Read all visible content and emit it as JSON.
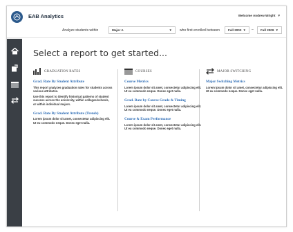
{
  "app": {
    "title": "EAB  Analytics",
    "welcome": "Welcome Andrew Wright",
    "logo_icon": "eab-logo-icon"
  },
  "filters": {
    "label_analyze": "Analyze students within",
    "major_value": "Major A",
    "label_enrolled": "who first enrolled between",
    "from_value": "Fall 2003",
    "dash": "–",
    "to_value": "Fall 2009"
  },
  "sidebar": {
    "items": [
      {
        "icon": "home-icon"
      },
      {
        "icon": "report-edit-icon"
      },
      {
        "icon": "courses-icon"
      },
      {
        "icon": "switch-arrows-icon"
      }
    ]
  },
  "main": {
    "heading": "Select a report to get started...",
    "columns": [
      {
        "title": "GRADUATION RATES",
        "icon": "bar-chart-icon",
        "reports": [
          {
            "title": "Grad. Rate By Student Attribute",
            "desc": "This report analyzes graduation rates for students across various attributes.",
            "desc2": "Use this report to identify historical patterns of student success across the university, within colleges/schools, or within individual majors."
          },
          {
            "title": "Grad. Rate By Student Attribute (Trends)",
            "desc": "Lorem ipsum dolor sit amet, consectetur adipiscing elit. Ut eu commodo neque. Donec eget nulla."
          }
        ]
      },
      {
        "title": "COURSES",
        "icon": "courses-icon",
        "reports": [
          {
            "title": "Course Metrics",
            "desc": "Lorem ipsum dolor sit amet, consectetur adipiscing elit. Ut eu commodo neque. Donec eget nulla."
          },
          {
            "title": "Grad. Rate by Course Grade & Timing",
            "desc": "Lorem ipsum dolor sit amet, consectetur adipiscing elit. Ut eu commodo neque. Donec eget nulla."
          },
          {
            "title": "Course & Exam Performance",
            "desc": "Lorem ipsum dolor sit amet, consectetur adipiscing elit. Ut eu commodo neque. Donec eget nulla."
          }
        ]
      },
      {
        "title": "MAJOR SWITCHING",
        "icon": "switch-arrows-icon",
        "reports": [
          {
            "title": "Major Switching Metrics",
            "desc": "Lorem ipsum dolor sit amet, consectetur adipiscing elit. Ut eu commodo neque. Donec eget nulla."
          }
        ]
      }
    ]
  },
  "colors": {
    "link": "#2d6cb5",
    "sidebar": "#3a3f45",
    "logo": "#2c5a8c"
  }
}
